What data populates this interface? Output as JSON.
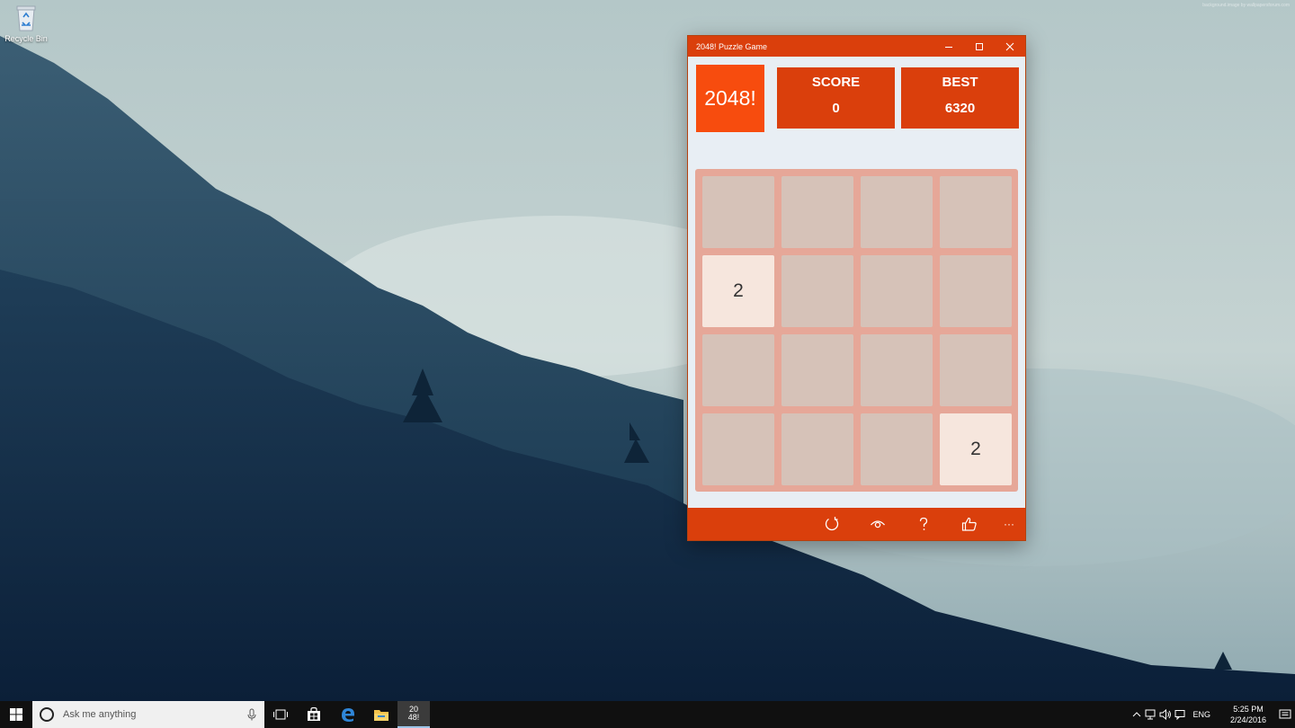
{
  "desktop": {
    "icons": [
      {
        "label": "Recycle Bin",
        "icon": "recycle-bin-icon"
      }
    ],
    "watermark": "background.image by wallpapersforum.com"
  },
  "window": {
    "title": "2048! Puzzle Game",
    "controls": [
      "minimize-icon",
      "maximize-icon",
      "close-icon"
    ],
    "accent_color": "#da3f0c",
    "logo_text": "2048!",
    "score_label": "SCORE",
    "score_value": "0",
    "best_label": "BEST",
    "best_value": "6320",
    "board": [
      [
        "",
        "",
        "",
        ""
      ],
      [
        "2",
        "",
        "",
        ""
      ],
      [
        "",
        "",
        "",
        ""
      ],
      [
        "",
        "",
        "",
        "2"
      ]
    ],
    "appbar": [
      "refresh-icon",
      "eye-icon",
      "help-icon",
      "thumbs-up-icon",
      "more-icon"
    ],
    "appbar_more": "···"
  },
  "taskbar": {
    "search_placeholder": "Ask me anything",
    "pinned": [
      "windows-start-icon",
      "task-view-icon",
      "store-icon",
      "edge-icon",
      "file-explorer-icon",
      "2048-app-icon"
    ],
    "active_app_label_line1": "20",
    "active_app_label_line2": "48!",
    "tray_language": "ENG",
    "time": "5:25 PM",
    "date": "2/24/2016"
  }
}
